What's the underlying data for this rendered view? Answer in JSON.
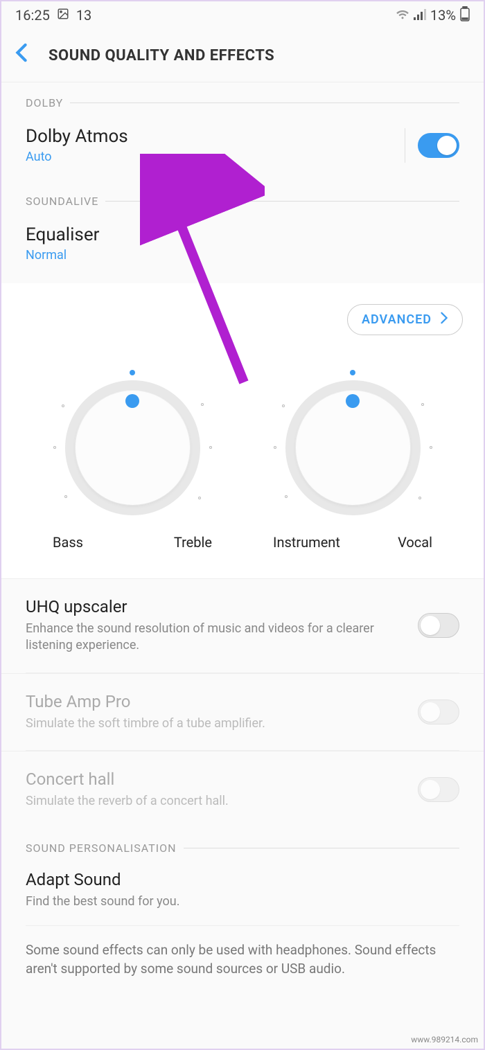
{
  "status": {
    "time": "16:25",
    "notif_count": "13",
    "battery": "13%"
  },
  "header": {
    "title": "SOUND QUALITY AND EFFECTS"
  },
  "sections": {
    "dolby_label": "DOLBY",
    "soundalive_label": "SOUNDALIVE",
    "personalisation_label": "SOUND PERSONALISATION"
  },
  "dolby": {
    "title": "Dolby Atmos",
    "sub": "Auto"
  },
  "equaliser": {
    "title": "Equaliser",
    "sub": "Normal"
  },
  "advanced_label": "ADVANCED",
  "dials": {
    "left_a": "Bass",
    "left_b": "Treble",
    "right_a": "Instrument",
    "right_b": "Vocal"
  },
  "uhq": {
    "title": "UHQ upscaler",
    "desc": "Enhance the sound resolution of music and videos for a clearer listening experience."
  },
  "tube": {
    "title": "Tube Amp Pro",
    "desc": "Simulate the soft timbre of a tube amplifier."
  },
  "concert": {
    "title": "Concert hall",
    "desc": "Simulate the reverb of a concert hall."
  },
  "adapt": {
    "title": "Adapt Sound",
    "desc": "Find the best sound for you."
  },
  "footer": "Some sound effects can only be used with headphones. Sound effects aren't supported by some sound sources or USB audio.",
  "watermark": "www.989214.com"
}
